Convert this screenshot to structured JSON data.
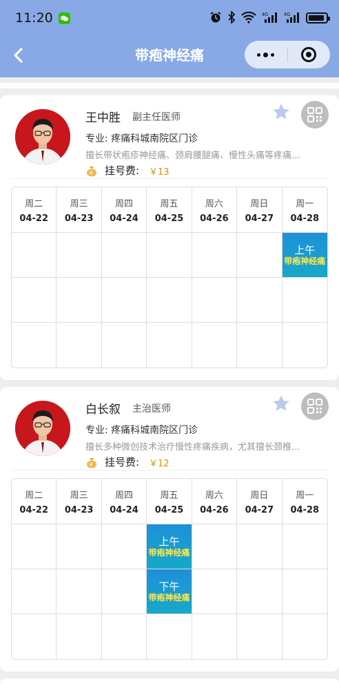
{
  "status_bar": {
    "time": "11:20",
    "signal1": "4G",
    "signal2": "4G"
  },
  "nav": {
    "title": "带疱神经痛"
  },
  "doctors": [
    {
      "name": "王中胜",
      "title": "副主任医师",
      "specialty": "专业: 疼痛科城南院区门诊",
      "skill": "擅长带状疱疹神经痛、颈肩腰腿痛、慢性头痛等疼痛…",
      "fee_label": "挂号费:",
      "fee_value": "￥13",
      "schedule": {
        "days": [
          {
            "weekday": "周二",
            "date": "04-22"
          },
          {
            "weekday": "周三",
            "date": "04-23"
          },
          {
            "weekday": "周四",
            "date": "04-24"
          },
          {
            "weekday": "周五",
            "date": "04-25"
          },
          {
            "weekday": "周六",
            "date": "04-26"
          },
          {
            "weekday": "周日",
            "date": "04-27"
          },
          {
            "weekday": "周一",
            "date": "04-28"
          }
        ],
        "slot_am": {
          "time": "上午",
          "dept": "带疱神经痛"
        }
      }
    },
    {
      "name": "白长叙",
      "title": "主治医师",
      "specialty": "专业: 疼痛科城南院区门诊",
      "skill": "擅长多种微创技术治疗慢性疼痛疾病，尤其擅长颈椎…",
      "fee_label": "挂号费:",
      "fee_value": "￥12",
      "schedule": {
        "days": [
          {
            "weekday": "周二",
            "date": "04-22"
          },
          {
            "weekday": "周三",
            "date": "04-23"
          },
          {
            "weekday": "周四",
            "date": "04-24"
          },
          {
            "weekday": "周五",
            "date": "04-25"
          },
          {
            "weekday": "周六",
            "date": "04-26"
          },
          {
            "weekday": "周日",
            "date": "04-27"
          },
          {
            "weekday": "周一",
            "date": "04-28"
          }
        ],
        "slot_am": {
          "time": "上午",
          "dept": "带疱神经痛"
        },
        "slot_pm": {
          "time": "下午",
          "dept": "带疱神经痛"
        }
      }
    }
  ],
  "colors": {
    "header": "#89a9e6",
    "slot": "#1f8fd9",
    "slot_dept": "#ffe94d",
    "fee": "#d69400"
  }
}
